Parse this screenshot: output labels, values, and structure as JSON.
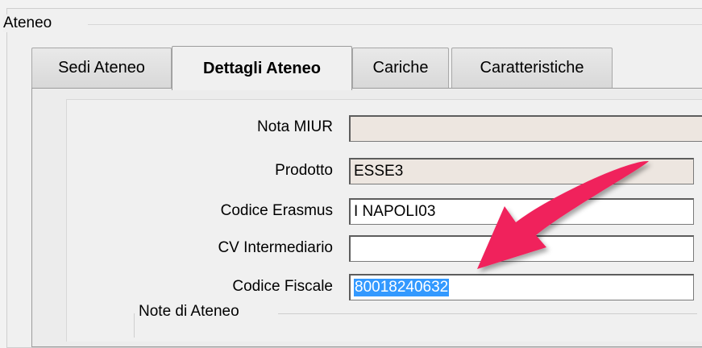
{
  "group": {
    "title": "Ateneo"
  },
  "tabs": [
    {
      "label": "Sedi Ateneo",
      "active": false
    },
    {
      "label": "Dettagli Ateneo",
      "active": true
    },
    {
      "label": "Cariche",
      "active": false
    },
    {
      "label": "Caratteristiche",
      "active": false
    }
  ],
  "form": {
    "nota_miur": {
      "label": "Nota MIUR",
      "value": ""
    },
    "prodotto": {
      "label": "Prodotto",
      "value": "ESSE3"
    },
    "codice_erasmus": {
      "label": "Codice Erasmus",
      "value": "I NAPOLI03"
    },
    "cv_intermediario": {
      "label": "CV Intermediario",
      "value": ""
    },
    "codice_fiscale": {
      "label": "Codice Fiscale",
      "value": "80018240632"
    }
  },
  "notes_group": {
    "title": "Note di Ateneo"
  },
  "colors": {
    "arrow": "#f0245c",
    "selection": "#3399ff"
  }
}
